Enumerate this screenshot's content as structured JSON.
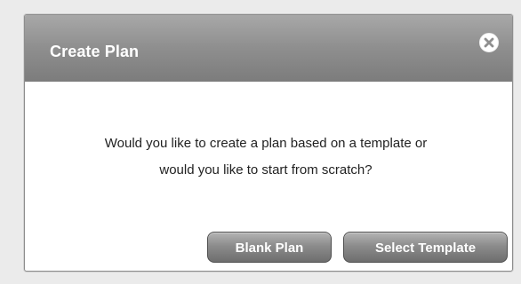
{
  "dialog": {
    "title": "Create Plan",
    "message_line_1": "Would you like to create a plan based on a template or",
    "message_line_2": "would you like to start from scratch?"
  },
  "buttons": {
    "blank_plan": "Blank Plan",
    "select_template": "Select Template"
  },
  "icons": {
    "close": "close-icon"
  },
  "colors": {
    "header_top": "#a8a8a8",
    "header_bottom": "#7c7c7c",
    "button_top": "#b4b4b4",
    "button_bottom": "#6e6e6e",
    "text": "#222222"
  }
}
